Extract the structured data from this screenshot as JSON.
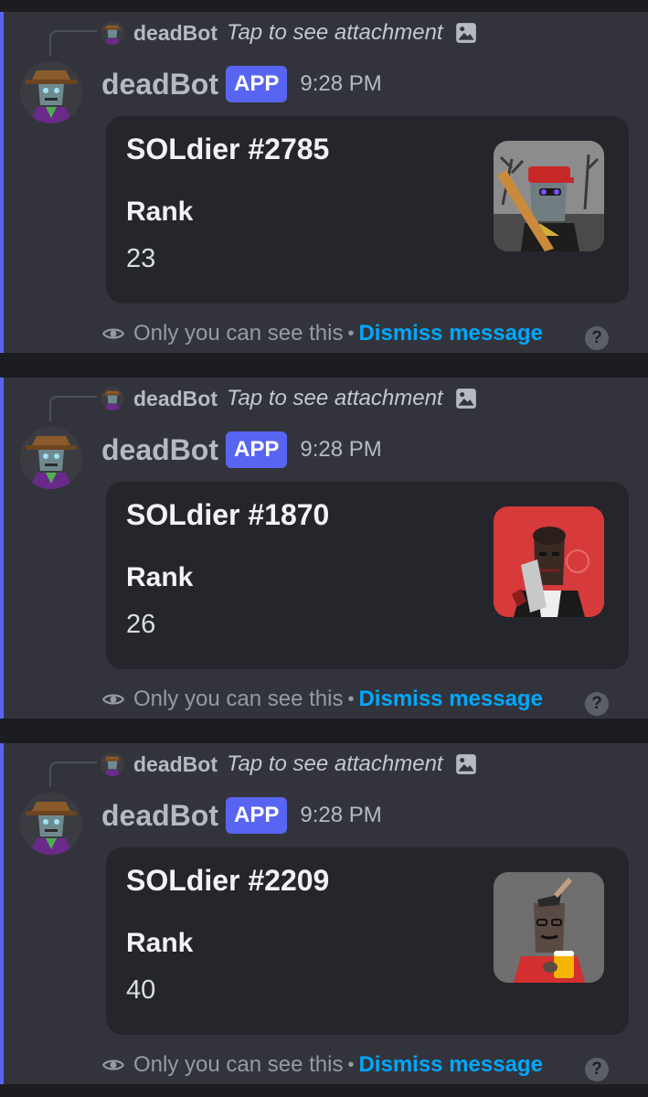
{
  "messages": [
    {
      "reply": {
        "author": "deadBot",
        "text": "Tap to see attachment",
        "icon": "image-icon"
      },
      "author": "deadBot",
      "badge": "APP",
      "timestamp": "9:28 PM",
      "embed": {
        "title": "SOLdier #2785",
        "field_name": "Rank",
        "field_value": "23",
        "thumbnail": "soldier-2785-image"
      },
      "footer": {
        "ephemeral_text": "Only you can see this",
        "separator": "•",
        "dismiss_label": "Dismiss message",
        "help_label": "?"
      }
    },
    {
      "reply": {
        "author": "deadBot",
        "text": "Tap to see attachment",
        "icon": "image-icon"
      },
      "author": "deadBot",
      "badge": "APP",
      "timestamp": "9:28 PM",
      "embed": {
        "title": "SOLdier #1870",
        "field_name": "Rank",
        "field_value": "26",
        "thumbnail": "soldier-1870-image"
      },
      "footer": {
        "ephemeral_text": "Only you can see this",
        "separator": "•",
        "dismiss_label": "Dismiss message",
        "help_label": "?"
      }
    },
    {
      "reply": {
        "author": "deadBot",
        "text": "Tap to see attachment",
        "icon": "image-icon"
      },
      "author": "deadBot",
      "badge": "APP",
      "timestamp": "9:28 PM",
      "embed": {
        "title": "SOLdier #2209",
        "field_name": "Rank",
        "field_value": "40",
        "thumbnail": "soldier-2209-image"
      },
      "footer": {
        "ephemeral_text": "Only you can see this",
        "separator": "•",
        "dismiss_label": "Dismiss message",
        "help_label": "?"
      }
    }
  ],
  "colors": {
    "background": "#1c1d21",
    "message_bg": "#33343b",
    "embed_bg": "#25262b",
    "accent": "#5865f2",
    "link": "#00a8fc",
    "muted_text": "#949ba4"
  }
}
